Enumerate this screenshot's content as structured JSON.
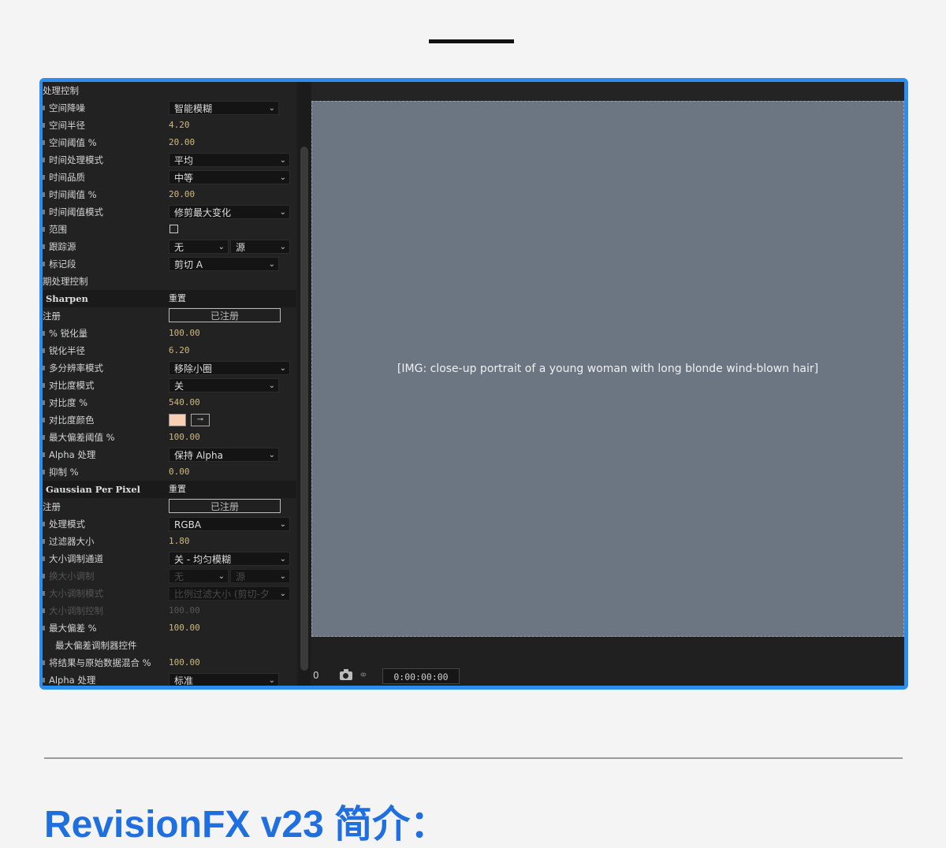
{
  "panel": {
    "rows": [
      {
        "kind": "header",
        "label": "处理控制"
      },
      {
        "kind": "dropdown",
        "label": "空间降噪",
        "value": "智能模糊"
      },
      {
        "kind": "value",
        "label": "空间半径",
        "value": "4.20"
      },
      {
        "kind": "value",
        "label": "空间阈值 %",
        "value": "20.00"
      },
      {
        "kind": "dropdown-wide",
        "label": "时间处理模式",
        "value": "平均"
      },
      {
        "kind": "dropdown-wide",
        "label": "时间品质",
        "value": "中等"
      },
      {
        "kind": "value",
        "label": "时间阈值 %",
        "value": "20.00"
      },
      {
        "kind": "dropdown-wide",
        "label": "时间阈值模式",
        "value": "修剪最大变化"
      },
      {
        "kind": "checkbox",
        "label": "范围"
      },
      {
        "kind": "dual",
        "label": "跟踪源",
        "value": "无",
        "value2": "源"
      },
      {
        "kind": "dropdown",
        "label": "标记段",
        "value": "剪切 A"
      },
      {
        "kind": "header",
        "label": "期处理控制"
      },
      {
        "kind": "section",
        "label": "Sharpen",
        "value": "重置"
      },
      {
        "kind": "register",
        "label": "注册",
        "value": "已注册"
      },
      {
        "kind": "value",
        "label": "% 锐化量",
        "value": "100.00"
      },
      {
        "kind": "value",
        "label": "锐化半径",
        "value": "6.20"
      },
      {
        "kind": "dropdown-wide",
        "label": "多分辨率模式",
        "value": "移除小圈"
      },
      {
        "kind": "dropdown",
        "label": "对比度模式",
        "value": "关"
      },
      {
        "kind": "value",
        "label": "对比度 %",
        "value": "540.00"
      },
      {
        "kind": "color",
        "label": "对比度颜色"
      },
      {
        "kind": "value",
        "label": "最大偏差阈值 %",
        "value": "100.00"
      },
      {
        "kind": "dropdown",
        "label": "Alpha 处理",
        "value": "保持 Alpha"
      },
      {
        "kind": "value",
        "label": "抑制 %",
        "value": "0.00"
      },
      {
        "kind": "section",
        "label": "Gaussian Per Pixel",
        "value": "重置"
      },
      {
        "kind": "register",
        "label": "注册",
        "value": "已注册"
      },
      {
        "kind": "dropdown-wide",
        "label": "处理模式",
        "value": "RGBA"
      },
      {
        "kind": "value",
        "label": "过滤器大小",
        "value": "1.80"
      },
      {
        "kind": "dropdown-wide",
        "label": "大小调制通道",
        "value": "关 - 均匀模糊"
      },
      {
        "kind": "dual-dim",
        "label": "换大小调制",
        "value": "无",
        "value2": "源"
      },
      {
        "kind": "dropdown-dim",
        "label": "大小调制模式",
        "value": "比例过滤大小 (剪切-夕"
      },
      {
        "kind": "value-dim",
        "label": "大小调制控制",
        "value": "100.00"
      },
      {
        "kind": "value",
        "label": "最大偏差 %",
        "value": "100.00"
      },
      {
        "kind": "plain",
        "label": "最大偏差调制器控件"
      },
      {
        "kind": "value",
        "label": "将结果与原始数据混合 %",
        "value": "100.00"
      },
      {
        "kind": "dropdown",
        "label": "Alpha 处理",
        "value": "标准"
      }
    ]
  },
  "viewer": {
    "left_readout": "0",
    "timecode": "0:00:00:00"
  },
  "heading": "RevisionFX v23 简介：",
  "colors": {
    "frame": "#2b8df0",
    "heading": "#1f6fe0",
    "value": "#d0b97c"
  }
}
